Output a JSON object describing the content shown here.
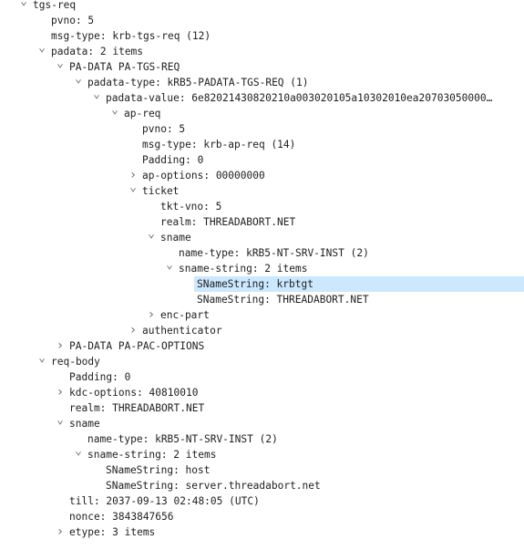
{
  "tree": {
    "rows": [
      {
        "level": 0,
        "state": "expanded",
        "text": "tgs-req"
      },
      {
        "level": 1,
        "state": "leaf",
        "text": "pvno: 5"
      },
      {
        "level": 1,
        "state": "leaf",
        "text": "msg-type: krb-tgs-req (12)"
      },
      {
        "level": 1,
        "state": "expanded",
        "text": "padata: 2 items"
      },
      {
        "level": 2,
        "state": "expanded",
        "text": "PA-DATA PA-TGS-REQ"
      },
      {
        "level": 3,
        "state": "expanded",
        "text": "padata-type: kRB5-PADATA-TGS-REQ (1)"
      },
      {
        "level": 4,
        "state": "expanded",
        "text": "padata-value: 6e82021430820210a003020105a10302010ea20703050000…"
      },
      {
        "level": 5,
        "state": "expanded",
        "text": "ap-req"
      },
      {
        "level": 6,
        "state": "leaf",
        "text": "pvno: 5"
      },
      {
        "level": 6,
        "state": "leaf",
        "text": "msg-type: krb-ap-req (14)"
      },
      {
        "level": 6,
        "state": "leaf",
        "text": "Padding: 0"
      },
      {
        "level": 6,
        "state": "collapsed",
        "text": "ap-options: 00000000"
      },
      {
        "level": 6,
        "state": "expanded",
        "text": "ticket"
      },
      {
        "level": 7,
        "state": "leaf",
        "text": "tkt-vno: 5"
      },
      {
        "level": 7,
        "state": "leaf",
        "text": "realm: THREADABORT.NET"
      },
      {
        "level": 7,
        "state": "expanded",
        "text": "sname"
      },
      {
        "level": 8,
        "state": "leaf",
        "text": "name-type: kRB5-NT-SRV-INST (2)"
      },
      {
        "level": 8,
        "state": "expanded",
        "text": "sname-string: 2 items"
      },
      {
        "level": 9,
        "state": "leaf",
        "text": "SNameString: krbtgt",
        "selected": true
      },
      {
        "level": 9,
        "state": "leaf",
        "text": "SNameString: THREADABORT.NET"
      },
      {
        "level": 7,
        "state": "collapsed",
        "text": "enc-part"
      },
      {
        "level": 6,
        "state": "collapsed",
        "text": "authenticator"
      },
      {
        "level": 2,
        "state": "collapsed",
        "text": "PA-DATA PA-PAC-OPTIONS"
      },
      {
        "level": 1,
        "state": "expanded",
        "text": "req-body"
      },
      {
        "level": 2,
        "state": "leaf",
        "text": "Padding: 0"
      },
      {
        "level": 2,
        "state": "collapsed",
        "text": "kdc-options: 40810010"
      },
      {
        "level": 2,
        "state": "leaf",
        "text": "realm: THREADABORT.NET"
      },
      {
        "level": 2,
        "state": "expanded",
        "text": "sname"
      },
      {
        "level": 3,
        "state": "leaf",
        "text": "name-type: kRB5-NT-SRV-INST (2)"
      },
      {
        "level": 3,
        "state": "expanded",
        "text": "sname-string: 2 items"
      },
      {
        "level": 4,
        "state": "leaf",
        "text": "SNameString: host"
      },
      {
        "level": 4,
        "state": "leaf",
        "text": "SNameString: server.threadabort.net"
      },
      {
        "level": 2,
        "state": "leaf",
        "text": "till: 2037-09-13 02:48:05 (UTC)"
      },
      {
        "level": 2,
        "state": "leaf",
        "text": "nonce: 3843847656"
      },
      {
        "level": 2,
        "state": "collapsed",
        "text": "etype: 3 items"
      }
    ]
  },
  "icons": {
    "expanded": "⌄",
    "collapsed": "›"
  },
  "colors": {
    "selection": "#cce8ff",
    "text": "#1e1e1e",
    "chevron": "#707070"
  }
}
